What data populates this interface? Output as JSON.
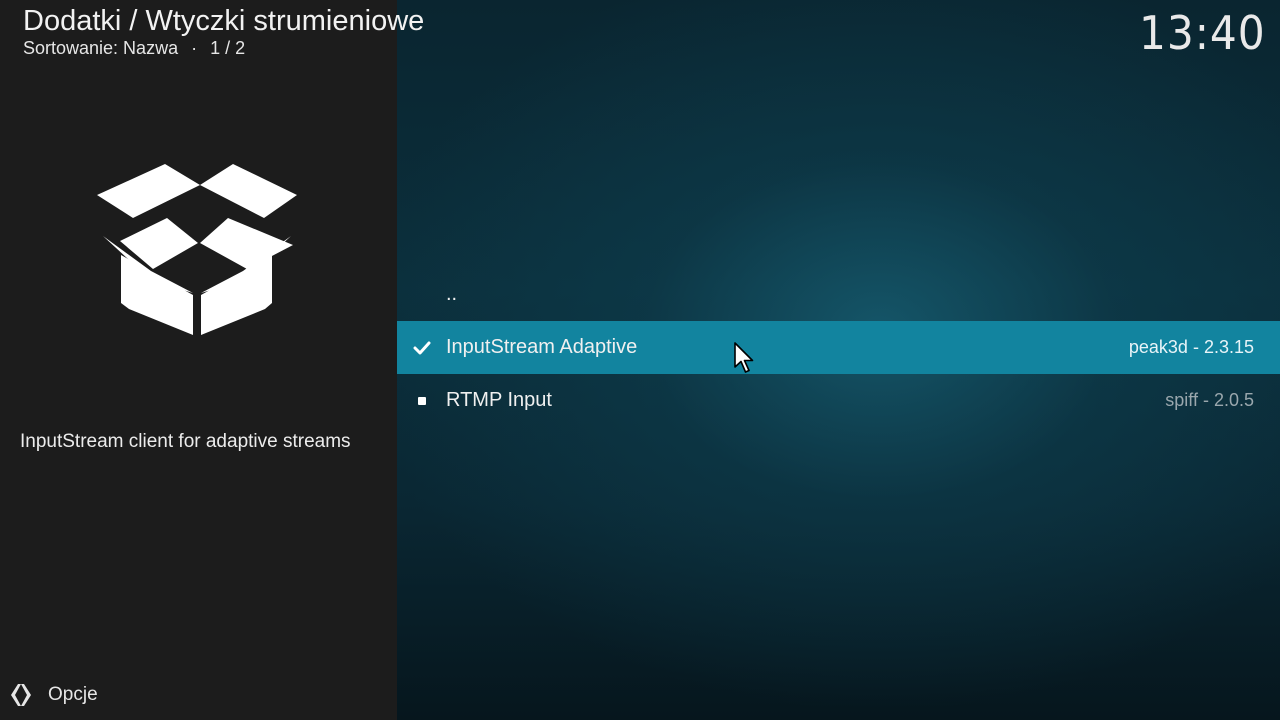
{
  "header": {
    "title": "Dodatki / Wtyczki strumieniowe",
    "sort_label": "Sortowanie: Nazwa",
    "separator": "·",
    "page": "1 / 2"
  },
  "clock": "13:40",
  "info": {
    "icon": "open-box-icon",
    "description": "InputStream client for adaptive streams"
  },
  "footer": {
    "options_label": "Opcje",
    "options_icon": "options-icon"
  },
  "list": {
    "items": [
      {
        "label": "..",
        "meta": "",
        "status": "none",
        "selected": false
      },
      {
        "label": "InputStream Adaptive",
        "meta": "peak3d - 2.3.15",
        "status": "enabled",
        "selected": true
      },
      {
        "label": "RTMP Input",
        "meta": "spiff - 2.0.5",
        "status": "installed",
        "selected": false
      }
    ]
  },
  "colors": {
    "highlight": "#12849f",
    "panel": "#1c1c1c"
  }
}
